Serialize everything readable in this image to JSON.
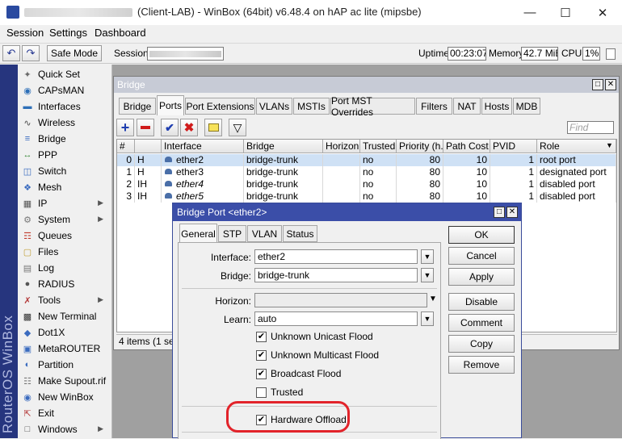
{
  "window": {
    "title": "(Client-LAB) - WinBox (64bit) v6.48.4 on hAP ac lite (mipsbe)",
    "minimize_icon": "minimize-icon",
    "maximize_icon": "maximize-icon",
    "close_icon": "close-icon"
  },
  "menu": [
    "Session",
    "Settings",
    "Dashboard"
  ],
  "toolbar": {
    "undo_icon": "undo-icon",
    "redo_icon": "redo-icon",
    "safe_mode": "Safe Mode",
    "session_label": "Session:",
    "uptime_label": "Uptime:",
    "uptime_value": "00:23:07",
    "memory_label": "Memory:",
    "memory_value": "42.7 MiB",
    "cpu_label": "CPU:",
    "cpu_value": "1%"
  },
  "brand_vertical": "RouterOS WinBox",
  "sidebar": [
    {
      "label": "Quick Set",
      "icon": "wand-icon"
    },
    {
      "label": "CAPsMAN",
      "icon": "capsman-icon"
    },
    {
      "label": "Interfaces",
      "icon": "interfaces-icon"
    },
    {
      "label": "Wireless",
      "icon": "wireless-icon"
    },
    {
      "label": "Bridge",
      "icon": "bridge-icon"
    },
    {
      "label": "PPP",
      "icon": "ppp-icon"
    },
    {
      "label": "Switch",
      "icon": "switch-icon"
    },
    {
      "label": "Mesh",
      "icon": "mesh-icon"
    },
    {
      "label": "IP",
      "icon": "ip-icon",
      "submenu": true
    },
    {
      "label": "System",
      "icon": "gear-icon",
      "submenu": true
    },
    {
      "label": "Queues",
      "icon": "queues-icon"
    },
    {
      "label": "Files",
      "icon": "folder-icon"
    },
    {
      "label": "Log",
      "icon": "log-icon"
    },
    {
      "label": "RADIUS",
      "icon": "radius-icon"
    },
    {
      "label": "Tools",
      "icon": "tools-icon",
      "submenu": true
    },
    {
      "label": "New Terminal",
      "icon": "terminal-icon"
    },
    {
      "label": "Dot1X",
      "icon": "dot1x-icon"
    },
    {
      "label": "MetaROUTER",
      "icon": "metarouter-icon"
    },
    {
      "label": "Partition",
      "icon": "partition-icon"
    },
    {
      "label": "Make Supout.rif",
      "icon": "supout-icon"
    },
    {
      "label": "New WinBox",
      "icon": "winbox-icon"
    },
    {
      "label": "Exit",
      "icon": "exit-icon"
    },
    {
      "label": "Windows",
      "icon": "windows-icon",
      "submenu": true
    }
  ],
  "bridge": {
    "title": "Bridge",
    "tabs": [
      "Bridge",
      "Ports",
      "Port Extensions",
      "VLANs",
      "MSTIs",
      "Port MST Overrides",
      "Filters",
      "NAT",
      "Hosts",
      "MDB"
    ],
    "active_tab": "Ports",
    "find_placeholder": "Find",
    "columns": [
      "#",
      "Interface",
      "Bridge",
      "Horizon",
      "Trusted",
      "Priority (h...",
      "Path Cost",
      "PVID",
      "Role"
    ],
    "rows": [
      {
        "num": "0",
        "flag": "H",
        "interface": "ether2",
        "bridge": "bridge-trunk",
        "horizon": "",
        "trusted": "no",
        "priority": "80",
        "path_cost": "10",
        "pvid": "1",
        "role": "root port",
        "italic": false
      },
      {
        "num": "1",
        "flag": "H",
        "interface": "ether3",
        "bridge": "bridge-trunk",
        "horizon": "",
        "trusted": "no",
        "priority": "80",
        "path_cost": "10",
        "pvid": "1",
        "role": "designated port",
        "italic": false
      },
      {
        "num": "2",
        "flag": "IH",
        "interface": "ether4",
        "bridge": "bridge-trunk",
        "horizon": "",
        "trusted": "no",
        "priority": "80",
        "path_cost": "10",
        "pvid": "1",
        "role": "disabled port",
        "italic": true
      },
      {
        "num": "3",
        "flag": "IH",
        "interface": "ether5",
        "bridge": "bridge-trunk",
        "horizon": "",
        "trusted": "no",
        "priority": "80",
        "path_cost": "10",
        "pvid": "1",
        "role": "disabled port",
        "italic": true
      }
    ],
    "status": "4 items (1 sele"
  },
  "dialog": {
    "title": "Bridge Port <ether2>",
    "tabs": [
      "General",
      "STP",
      "VLAN",
      "Status"
    ],
    "interface_label": "Interface:",
    "interface_value": "ether2",
    "bridge_label": "Bridge:",
    "bridge_value": "bridge-trunk",
    "horizon_label": "Horizon:",
    "horizon_value": "",
    "learn_label": "Learn:",
    "learn_value": "auto",
    "checkboxes": [
      {
        "label": "Unknown Unicast Flood",
        "checked": true
      },
      {
        "label": "Unknown Multicast Flood",
        "checked": true
      },
      {
        "label": "Broadcast Flood",
        "checked": true
      },
      {
        "label": "Trusted",
        "checked": false
      }
    ],
    "hw_offload": {
      "label": "Hardware Offload",
      "checked": true
    },
    "buttons": [
      "OK",
      "Cancel",
      "Apply",
      "Disable",
      "Comment",
      "Copy",
      "Remove"
    ]
  },
  "colors": {
    "brand_band": "#26357e",
    "dialog_title": "#3b4ea8",
    "selected_row": "#cfe1f5",
    "highlight": "#e2232a"
  }
}
